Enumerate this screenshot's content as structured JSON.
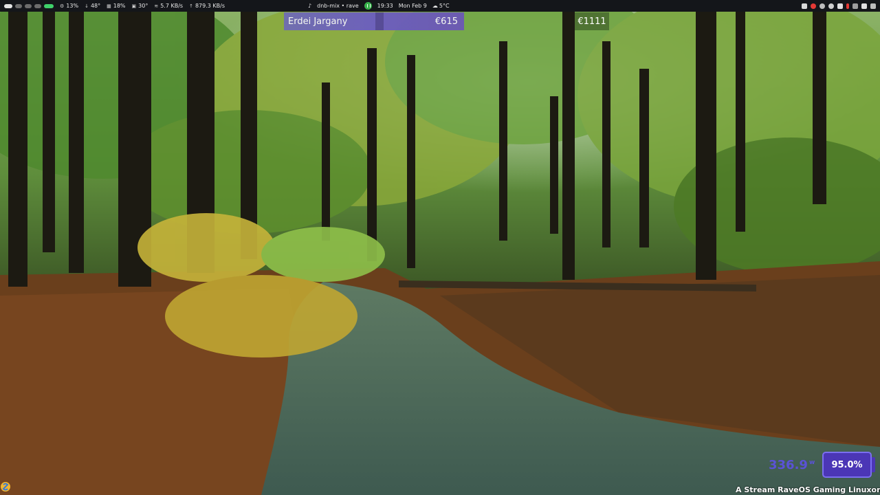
{
  "topbar": {
    "stats": [
      {
        "icon": "cpu-icon",
        "glyph": "⚙",
        "value": "13%"
      },
      {
        "icon": "temperature-icon",
        "glyph": "🌡",
        "value": "48°"
      },
      {
        "icon": "memory-icon",
        "glyph": "▦",
        "value": "18%"
      },
      {
        "icon": "disk-icon",
        "glyph": "▣",
        "value": "30°"
      },
      {
        "icon": "wifi-icon",
        "glyph": "≋",
        "value": "5.7 KB/s"
      },
      {
        "icon": "upload-icon",
        "glyph": "⬆",
        "value": "879.3 KB/s"
      }
    ],
    "now_playing": "dnb-mix • rave",
    "time": "19:33",
    "date": "Mon Feb 9",
    "weather": "5°C",
    "tray_colors": [
      "#d9d9d9",
      "#e53935",
      "#bdbdbd",
      "#cfcfcf",
      "#e0e0e0",
      "#e53935",
      "#9e9e9e",
      "#e0e0e0",
      "#bdbdbd"
    ]
  },
  "overlay": {
    "donor_name": "Erdei Jargany",
    "donor_amount": "€615",
    "goal_amount": "€1111",
    "power_value": "336.9",
    "power_unit": "w",
    "percent": "95.0%",
    "ticker": "A Stream RaveOS Gaming Linuxon fut"
  },
  "colors": {
    "accent_purple": "#4b36b6",
    "power_text": "#5a52d6",
    "cpu_green": "#3fd06a"
  }
}
